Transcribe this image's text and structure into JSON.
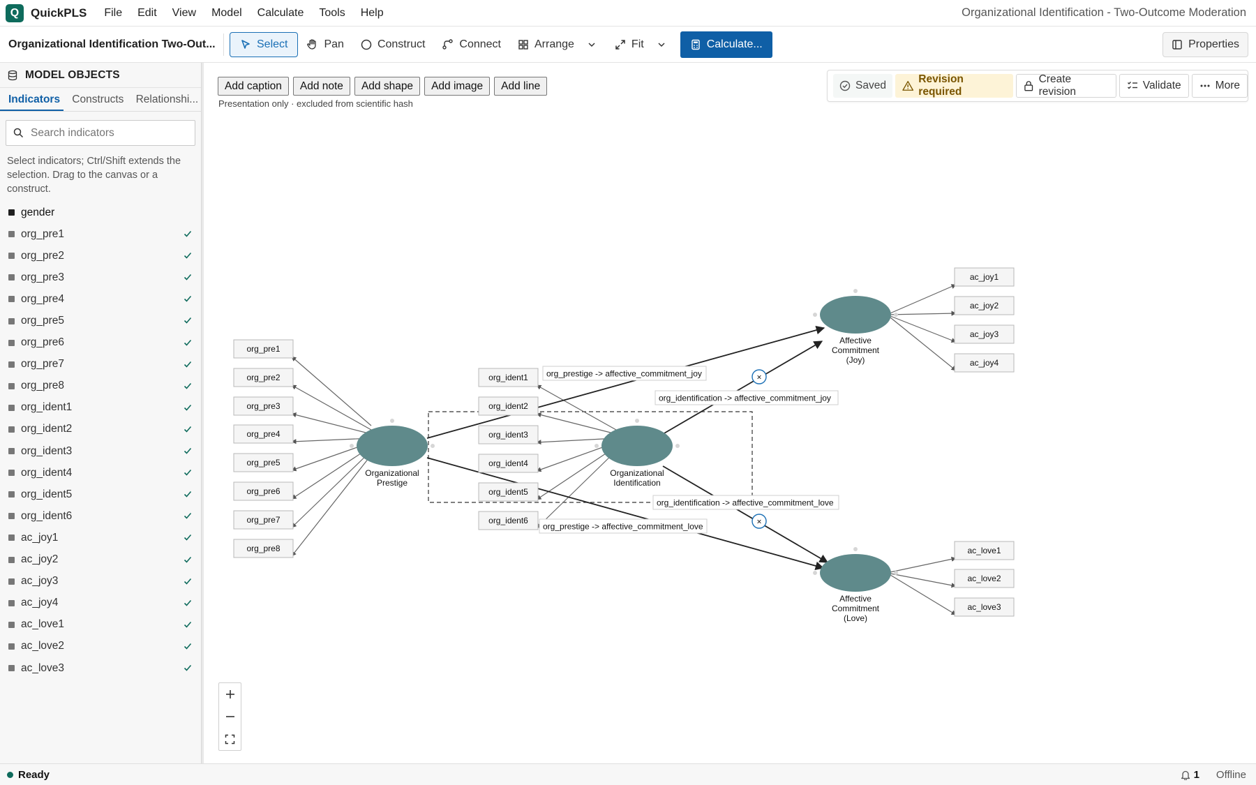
{
  "app": {
    "name": "QuickPLS",
    "logo_letter": "Q",
    "window_title": "Organizational Identification - Two-Outcome Moderation",
    "menu": [
      "File",
      "Edit",
      "View",
      "Model",
      "Calculate",
      "Tools",
      "Help"
    ]
  },
  "toolbar": {
    "model_title": "Organizational Identification Two-Out...",
    "select": "Select",
    "pan": "Pan",
    "construct": "Construct",
    "connect": "Connect",
    "arrange": "Arrange",
    "fit": "Fit",
    "calculate": "Calculate...",
    "properties": "Properties"
  },
  "sidebar": {
    "title": "MODEL OBJECTS",
    "tabs": [
      "Indicators",
      "Constructs",
      "Relationshi..."
    ],
    "active_tab": "Indicators",
    "search_placeholder": "Search indicators",
    "help": "Select indicators; Ctrl/Shift extends the selection. Drag to the canvas or a construct.",
    "indicators": [
      {
        "name": "gender",
        "assigned": false
      },
      {
        "name": "org_pre1",
        "assigned": true
      },
      {
        "name": "org_pre2",
        "assigned": true
      },
      {
        "name": "org_pre3",
        "assigned": true
      },
      {
        "name": "org_pre4",
        "assigned": true
      },
      {
        "name": "org_pre5",
        "assigned": true
      },
      {
        "name": "org_pre6",
        "assigned": true
      },
      {
        "name": "org_pre7",
        "assigned": true
      },
      {
        "name": "org_pre8",
        "assigned": true
      },
      {
        "name": "org_ident1",
        "assigned": true
      },
      {
        "name": "org_ident2",
        "assigned": true
      },
      {
        "name": "org_ident3",
        "assigned": true
      },
      {
        "name": "org_ident4",
        "assigned": true
      },
      {
        "name": "org_ident5",
        "assigned": true
      },
      {
        "name": "org_ident6",
        "assigned": true
      },
      {
        "name": "ac_joy1",
        "assigned": true
      },
      {
        "name": "ac_joy2",
        "assigned": true
      },
      {
        "name": "ac_joy3",
        "assigned": true
      },
      {
        "name": "ac_joy4",
        "assigned": true
      },
      {
        "name": "ac_love1",
        "assigned": true
      },
      {
        "name": "ac_love2",
        "assigned": true
      },
      {
        "name": "ac_love3",
        "assigned": true
      }
    ]
  },
  "canvas_tools": {
    "buttons": [
      "Add caption",
      "Add note",
      "Add shape",
      "Add image",
      "Add line"
    ],
    "note": "Presentation only · excluded from scientific hash"
  },
  "status_panel": {
    "saved": "Saved",
    "revision": "Revision required",
    "create_revision": "Create revision",
    "validate": "Validate",
    "more": "More"
  },
  "model": {
    "construct_color": "#5f8a8b",
    "constructs": [
      {
        "id": "prestige",
        "label_lines": [
          "Organizational",
          "Prestige"
        ]
      },
      {
        "id": "ident",
        "label_lines": [
          "Organizational",
          "Identification"
        ]
      },
      {
        "id": "joy",
        "label_lines": [
          "Affective",
          "Commitment",
          "(Joy)"
        ]
      },
      {
        "id": "love",
        "label_lines": [
          "Affective",
          "Commitment",
          "(Love)"
        ]
      }
    ],
    "indicator_labels": {
      "prestige": [
        "org_pre1",
        "org_pre2",
        "org_pre3",
        "org_pre4",
        "org_pre5",
        "org_pre6",
        "org_pre7",
        "org_pre8"
      ],
      "ident": [
        "org_ident1",
        "org_ident2",
        "org_ident3",
        "org_ident4",
        "org_ident5",
        "org_ident6"
      ],
      "joy": [
        "ac_joy1",
        "ac_joy2",
        "ac_joy3",
        "ac_joy4"
      ],
      "love": [
        "ac_love1",
        "ac_love2",
        "ac_love3"
      ]
    },
    "paths": [
      {
        "label": "org_prestige -> affective_commitment_joy"
      },
      {
        "label": "org_identification -> affective_commitment_joy"
      },
      {
        "label": "org_identification -> affective_commitment_love"
      },
      {
        "label": "org_prestige -> affective_commitment_love"
      }
    ],
    "interaction_symbol": "×"
  },
  "statusbar": {
    "status": "Ready",
    "notifications": "1",
    "connection": "Offline"
  }
}
